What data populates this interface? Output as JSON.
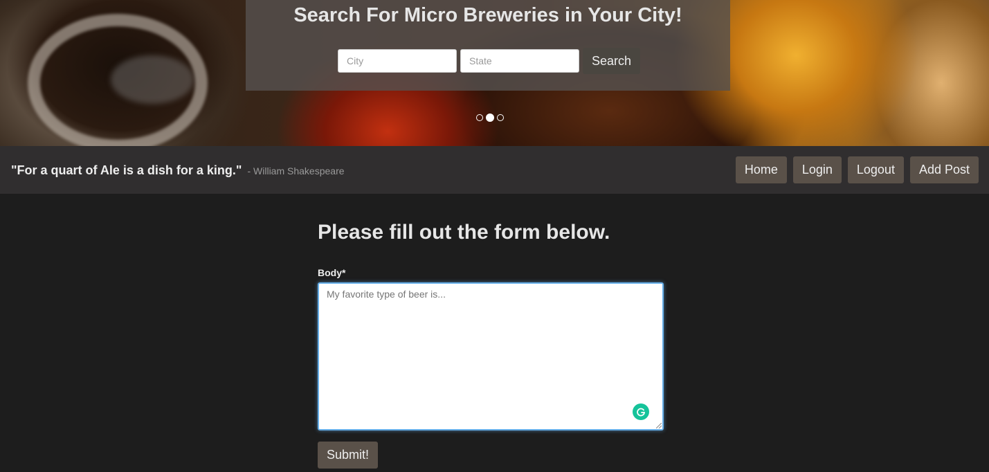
{
  "hero": {
    "title": "Search For Micro Breweries in Your City!",
    "city_placeholder": "City",
    "state_placeholder": "State",
    "search_label": "Search",
    "carousel_active_index": 1
  },
  "navbar": {
    "quote": "\"For a quart of Ale is a dish for a king.\"",
    "quote_author": "- William Shakespeare",
    "links": {
      "home": "Home",
      "login": "Login",
      "logout": "Logout",
      "add_post": "Add Post"
    }
  },
  "form": {
    "heading": "Please fill out the form below.",
    "body_label": "Body*",
    "body_placeholder": "My favorite type of beer is...",
    "submit_label": "Submit!"
  },
  "colors": {
    "accent_button": "#5a5149",
    "focus_ring": "#66afe9",
    "grammarly": "#15c39a"
  }
}
